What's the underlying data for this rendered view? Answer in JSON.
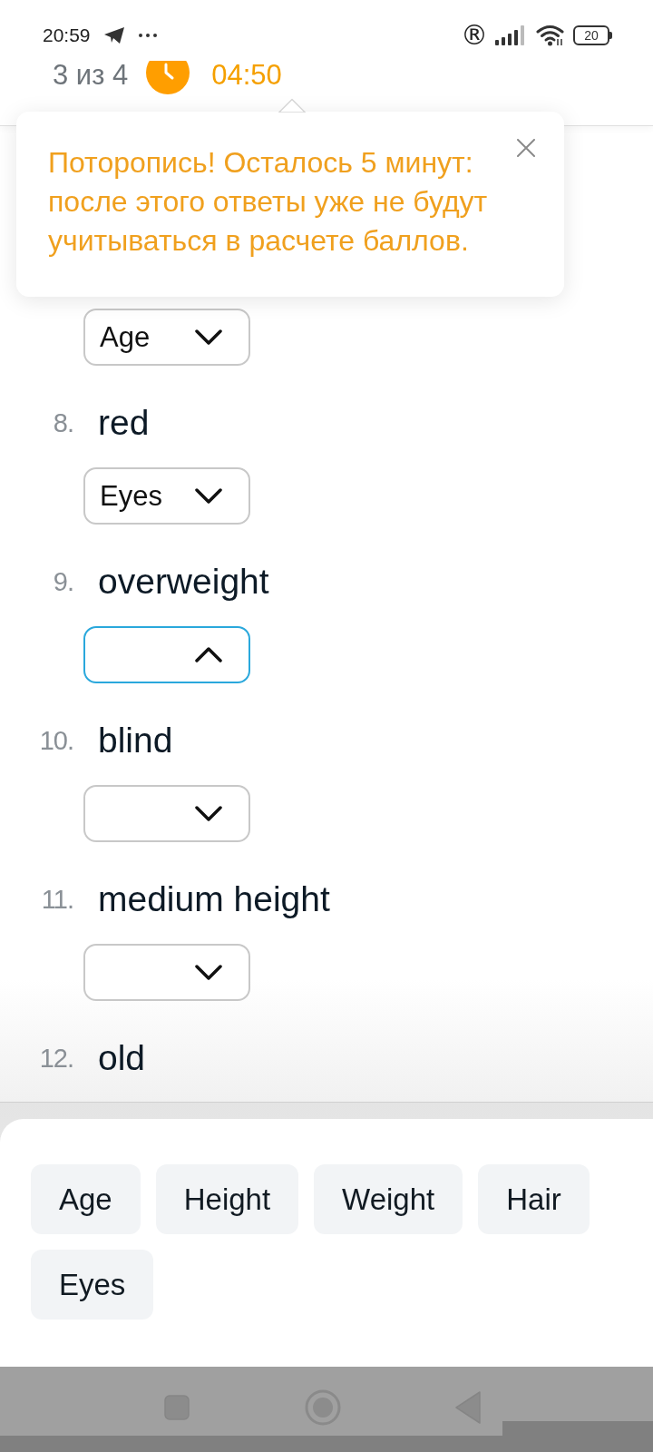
{
  "status_bar": {
    "time": "20:59",
    "roaming": "®",
    "battery": "20"
  },
  "header": {
    "progress": "3 из 4",
    "timer": "04:50"
  },
  "tooltip": {
    "lines": [
      "Поторопись! Осталось 5 минут:",
      "после этого ответы уже не будут",
      "учитываться в расчете баллов."
    ]
  },
  "questions": [
    {
      "dropdown": {
        "value": "Age",
        "expanded": false
      }
    },
    {
      "number": "8.",
      "word": "red",
      "dropdown": {
        "value": "Eyes",
        "expanded": false
      }
    },
    {
      "number": "9.",
      "word": "overweight",
      "dropdown": {
        "expanded": true
      }
    },
    {
      "number": "10.",
      "word": "blind",
      "dropdown": {
        "expanded": false
      }
    },
    {
      "number": "11.",
      "word": "medium height",
      "dropdown": {
        "expanded": false
      }
    },
    {
      "number": "12.",
      "word": "old"
    }
  ],
  "options": [
    "Age",
    "Height",
    "Weight",
    "Hair",
    "Eyes"
  ]
}
